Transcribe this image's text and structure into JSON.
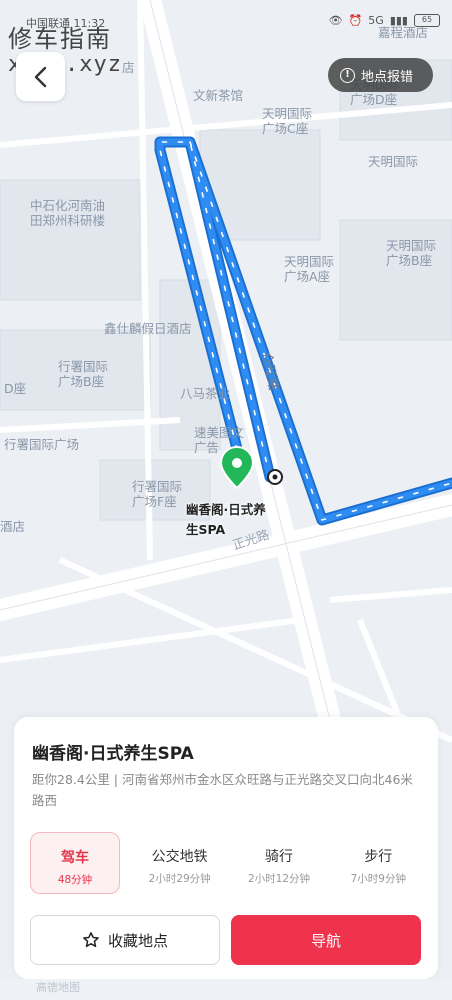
{
  "status_bar": {
    "carrier": "中国联通 11:32",
    "network": "5G",
    "battery": "65"
  },
  "watermark": {
    "line1": "修车指南",
    "line2": "xczn.xyz"
  },
  "report_button": {
    "label": "地点报错"
  },
  "map": {
    "labels": {
      "wenxin": "文新茶馆",
      "tianming_c": "天明国际\n广场C座",
      "tianming_d": "天明国际\n广场D座",
      "tianming_e": "天明国际",
      "tianming_a": "天明国际\n广场A座",
      "tianming_b": "天明国际\n广场B座",
      "sinopec": "中石化河南油\n田郑州科研楼",
      "xinshi": "鑫仕麟假日酒店",
      "xingshu_b": "行署国际\n广场B座",
      "bama": "八马茶业",
      "d_zuo": "D座",
      "xingshu_plaza": "行署国际广场",
      "sumei": "速美图文\n广告",
      "xingshu_f": "行署国际\n广场F座",
      "hotel_left": "酒店",
      "top_partial": "店",
      "top_right_partial": "嘉程酒店",
      "road_zhongwang": "众旺路",
      "road_zhengguang": "正光路"
    },
    "poi_name": "幽香阁·日式养\n生SPA",
    "route_color": "#2f8cf2",
    "pin_color": "#22b85a"
  },
  "card": {
    "title": "幽香阁·日式养生SPA",
    "address": "距你28.4公里 | 河南省郑州市金水区众旺路与正光路交叉口向北46米路西",
    "modes": [
      {
        "label": "驾车",
        "time": "48分钟"
      },
      {
        "label": "公交地铁",
        "time": "2小时29分钟"
      },
      {
        "label": "骑行",
        "time": "2小时12分钟"
      },
      {
        "label": "步行",
        "time": "7小时9分钟"
      }
    ],
    "save_label": "收藏地点",
    "nav_label": "导航",
    "accent": "#f0334d"
  },
  "bottom_strip": {
    "text": "高德地图"
  }
}
